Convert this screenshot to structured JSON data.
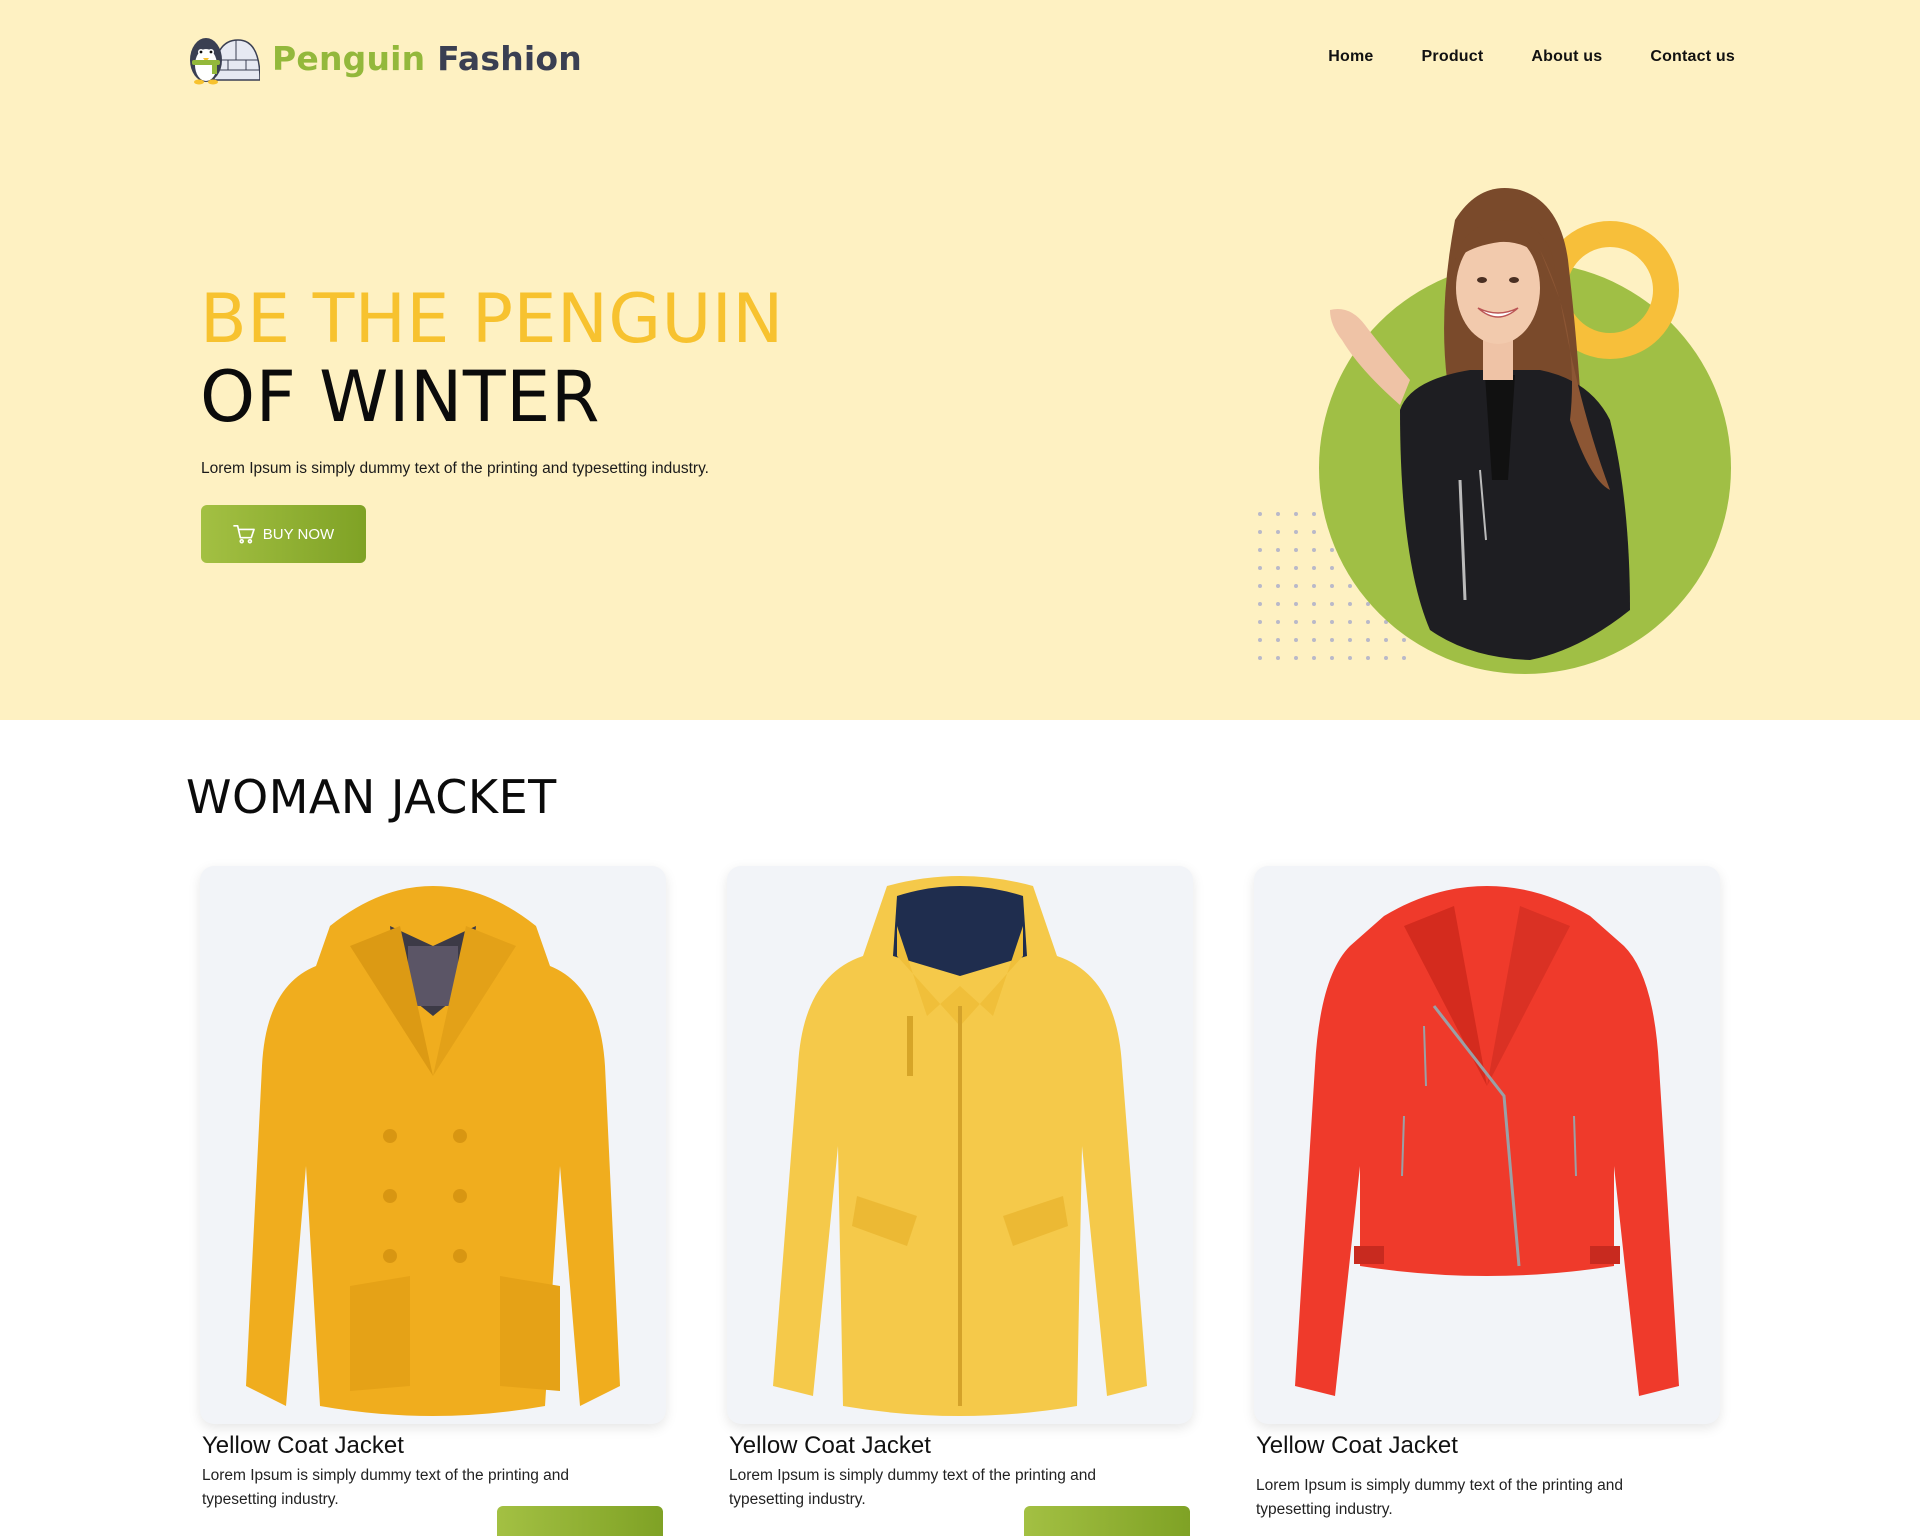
{
  "brand": {
    "part1": "Penguin",
    "part2": "Fashion",
    "logo_icon": "penguin-igloo-logo"
  },
  "nav": {
    "items": [
      "Home",
      "Product",
      "About us",
      "Contact us"
    ]
  },
  "hero": {
    "line1": "BE THE PENGUIN",
    "line2": "OF WINTER",
    "subtitle": "Lorem Ipsum is simply dummy text of the printing and typesetting industry.",
    "button_label": "BUY NOW",
    "button_icon": "cart-icon"
  },
  "section": {
    "title": "WOMAN JACKET"
  },
  "products": [
    {
      "title": "Yellow Coat Jacket",
      "desc": "Lorem Ipsum is simply dummy text of the printing and typesetting industry.",
      "color": "#f0ad1e"
    },
    {
      "title": "Yellow Coat Jacket",
      "desc": "Lorem Ipsum is simply dummy text of the printing and typesetting industry.",
      "color": "#f5c94a"
    },
    {
      "title": "Yellow Coat Jacket",
      "desc": "Lorem Ipsum is simply dummy text of the printing and typesetting industry.",
      "color": "#ef3a2b"
    }
  ],
  "colors": {
    "accent_green": "#93b83b",
    "accent_yellow": "#f7c22f",
    "hero_bg": "#fef1c2"
  }
}
